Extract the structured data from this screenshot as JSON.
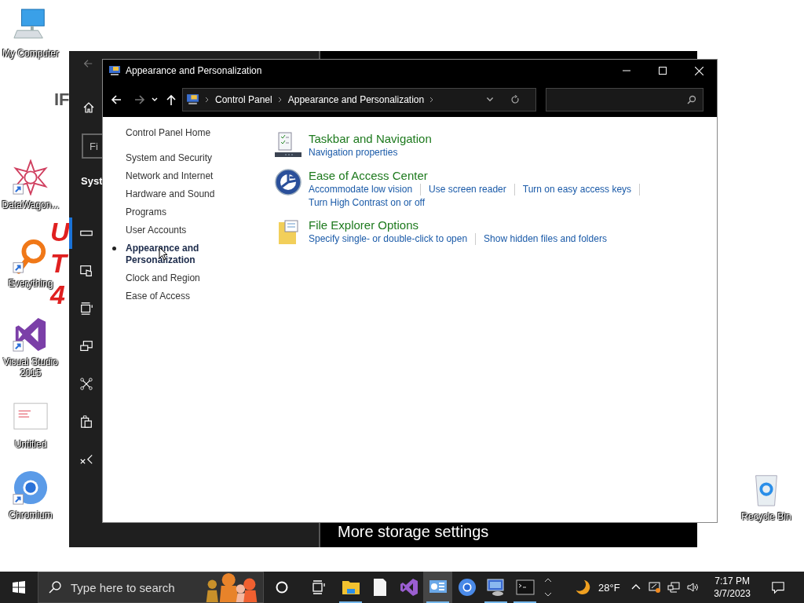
{
  "desktop": {
    "wallpaper_texts": [
      {
        "text": "IF",
        "kind": "gray"
      },
      {
        "text": "U",
        "kind": "red"
      },
      {
        "text": "T",
        "kind": "red"
      },
      {
        "text": "4",
        "kind": "red"
      }
    ],
    "icons": [
      {
        "label": "My Computer",
        "kind": "computer",
        "shortcut": false
      },
      {
        "label": "DataWagon...",
        "kind": "star",
        "shortcut": true
      },
      {
        "label": "Everything",
        "kind": "magnifier",
        "shortcut": true
      },
      {
        "label": "Visual Studio 2015",
        "kind": "vs",
        "shortcut": true
      },
      {
        "label": "Untitled",
        "kind": "document",
        "shortcut": false
      },
      {
        "label": "Chromium",
        "kind": "chromium",
        "shortcut": true
      },
      {
        "label": "Recycle Bin",
        "kind": "recycle",
        "shortcut": false
      }
    ]
  },
  "background_window": {
    "search_placeholder": "Fi",
    "heading": "Syst",
    "footer_link": "More storage settings",
    "nav": [
      {
        "kind": "storage",
        "selected": true
      },
      {
        "kind": "tablet",
        "selected": false
      },
      {
        "kind": "multitask",
        "selected": false
      },
      {
        "kind": "project",
        "selected": false
      },
      {
        "kind": "shared",
        "selected": false
      },
      {
        "kind": "clipboard",
        "selected": false
      },
      {
        "kind": "remote",
        "selected": false
      }
    ]
  },
  "window": {
    "title": "Appearance and Personalization",
    "breadcrumb": [
      "Control Panel",
      "Appearance and Personalization"
    ],
    "home_link": "Control Panel Home",
    "nav": [
      {
        "label": "System and Security",
        "selected": false
      },
      {
        "label": "Network and Internet",
        "selected": false
      },
      {
        "label": "Hardware and Sound",
        "selected": false
      },
      {
        "label": "Programs",
        "selected": false
      },
      {
        "label": "User Accounts",
        "selected": false
      },
      {
        "label": "Appearance and Personalization",
        "selected": true
      },
      {
        "label": "Clock and Region",
        "selected": false
      },
      {
        "label": "Ease of Access",
        "selected": false
      }
    ],
    "sections": [
      {
        "kind": "taskbar",
        "title": "Taskbar and Navigation",
        "links": [
          "Navigation properties"
        ]
      },
      {
        "kind": "ease",
        "title": "Ease of Access Center",
        "links": [
          "Accommodate low vision",
          "Use screen reader",
          "Turn on easy access keys",
          "Turn High Contrast on or off"
        ]
      },
      {
        "kind": "folder",
        "title": "File Explorer Options",
        "links": [
          "Specify single- or double-click to open",
          "Show hidden files and folders"
        ]
      }
    ]
  },
  "taskbar": {
    "search_placeholder": "Type here to search",
    "apps": [
      {
        "kind": "explorer",
        "running": true,
        "selected": false
      },
      {
        "kind": "document",
        "running": false,
        "selected": false
      },
      {
        "kind": "vs",
        "running": false,
        "selected": false
      },
      {
        "kind": "control-panel",
        "running": true,
        "selected": true
      },
      {
        "kind": "chromium",
        "running": false,
        "selected": false
      },
      {
        "kind": "monitor",
        "running": true,
        "selected": false
      },
      {
        "kind": "terminal",
        "running": true,
        "selected": false
      }
    ],
    "weather": "28°F",
    "time": "7:17 PM",
    "date": "3/7/2023"
  }
}
